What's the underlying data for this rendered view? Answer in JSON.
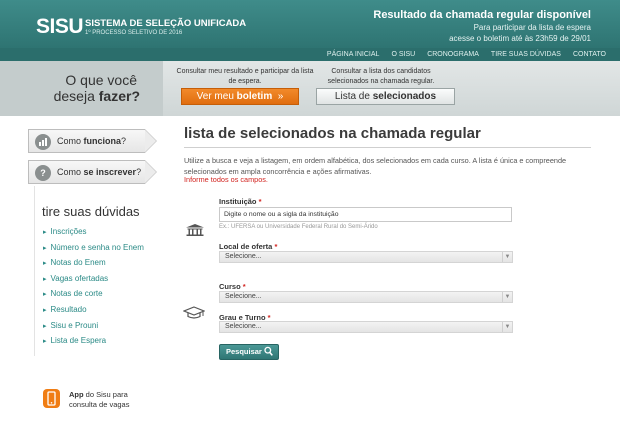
{
  "header": {
    "logo": "SISU",
    "title": "SISTEMA DE SELEÇÃO UNIFICADA",
    "subtitle": "1º PROCESSO SELETIVO DE 2016",
    "banner_title": "Resultado da chamada regular disponível",
    "banner_line1": "Para participar da lista de espera",
    "banner_line2": "acesse o boletim até às 23h59 de 29/01"
  },
  "nav": {
    "items": [
      "PÁGINA INICIAL",
      "O SISU",
      "CRONOGRAMA",
      "TIRE SUAS DÚVIDAS",
      "CONTATO"
    ]
  },
  "ask": {
    "line1": "O que você",
    "line2_prefix": "deseja ",
    "line2_bold": "fazer?",
    "cta1_text": "Consultar meu resultado e participar da lista de espera.",
    "cta1_button_prefix": "Ver meu ",
    "cta1_button_bold": "boletim",
    "cta1_button_arrow": "»",
    "cta2_text": "Consultar a lista dos candidatos selecionados na chamada regular.",
    "cta2_button_prefix": "Lista de ",
    "cta2_button_bold": "selecionados"
  },
  "sidebar": {
    "tab1_prefix": "Como ",
    "tab1_bold": "funciona",
    "tab1_suffix": "?",
    "tab2_prefix": "Como ",
    "tab2_bold": "se inscrever",
    "tab2_suffix": "?",
    "faq_title": "tire suas dúvidas",
    "faq_items": [
      "Inscrições",
      "Número e senha no Enem",
      "Notas do Enem",
      "Vagas ofertadas",
      "Notas de corte",
      "Resultado",
      "Sisu e Prouni",
      "Lista de Espera"
    ],
    "app_bold": "App",
    "app_text": " do Sisu para consulta de vagas"
  },
  "main": {
    "title": "lista de selecionados na chamada regular",
    "intro": "Utilize a busca e veja a listagem, em ordem alfabética, dos selecionados em cada curso. A lista é única e compreende selecionados em ampla concorrência e ações afirmativas.",
    "required_note": "Informe todos os campos.",
    "institution_label": "Instituição",
    "institution_value": "Digite o nome ou a sigla da instituição",
    "institution_hint": "Ex.: UFERSA ou Universidade Federal Rural do Semi-Árido",
    "local_label": "Local de oferta",
    "local_value": "Selecione...",
    "curso_label": "Curso",
    "curso_value": "Selecione...",
    "grau_label": "Grau e Turno",
    "grau_value": "Selecione...",
    "required_mark": "*",
    "search_button": "Pesquisar"
  },
  "colors": {
    "header_teal": "#2e7472",
    "accent_orange": "#e06d0f",
    "link_teal": "#2a8a86",
    "required_red": "#d2231f"
  }
}
